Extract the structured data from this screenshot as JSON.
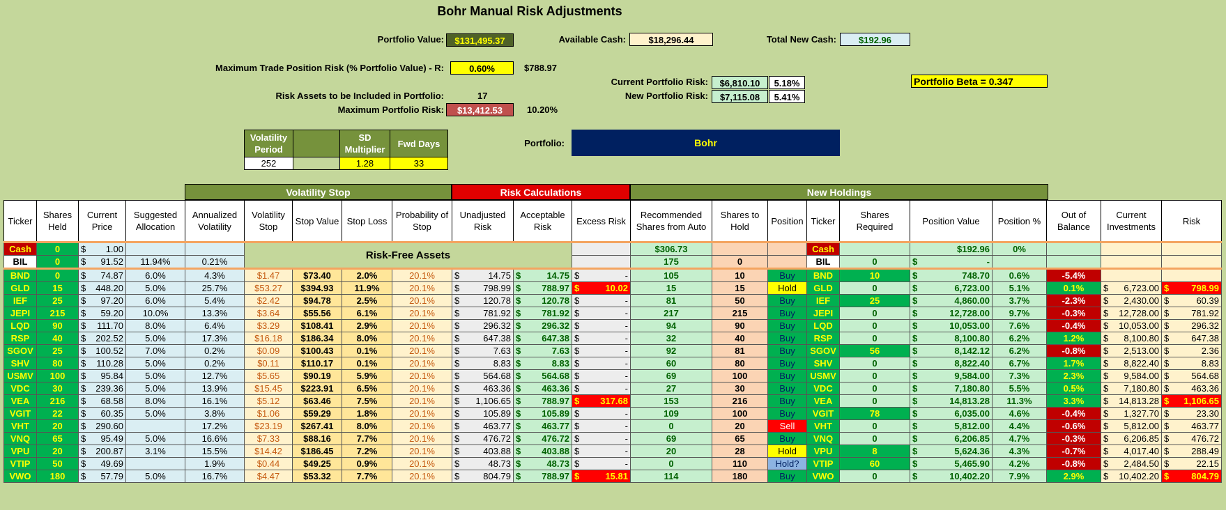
{
  "title": "Bohr Manual Risk Adjustments",
  "summary": {
    "portfolio_value_label": "Portfolio Value:",
    "portfolio_value": "$131,495.37",
    "available_cash_label": "Available Cash:",
    "available_cash": "$18,296.44",
    "total_new_cash_label": "Total New Cash:",
    "total_new_cash": "$192.96",
    "max_trade_risk_label": "Maximum Trade Position Risk (% Portfolio Value) - R:",
    "max_trade_risk_pct": "0.60%",
    "max_trade_risk_amt": "$788.97",
    "current_risk_label": "Current Portfolio Risk:",
    "current_risk_amt": "$6,810.10",
    "current_risk_pct": "5.18%",
    "new_risk_label": "New Portfolio Risk:",
    "new_risk_amt": "$7,115.08",
    "new_risk_pct": "5.41%",
    "beta_label": "Portfolio Beta =  0.347",
    "risk_assets_label": "Risk Assets to be Included in Portfolio:",
    "risk_assets": "17",
    "max_portfolio_risk_label": "Maximum Portfolio Risk:",
    "max_portfolio_risk_amt": "$13,412.53",
    "max_portfolio_risk_pct": "10.20%",
    "portfolio_label": "Portfolio:",
    "portfolio_name": "Bohr"
  },
  "params": {
    "volatility_period_label": "Volatility Period",
    "sd_multiplier_label": "SD Multiplier",
    "fwd_days_label": "Fwd Days",
    "volatility_period": "252",
    "sd_multiplier": "1.28",
    "fwd_days": "33"
  },
  "groups": {
    "volatility_stop": "Volatility Stop",
    "risk_calculations": "Risk Calculations",
    "new_holdings": "New Holdings"
  },
  "headers": [
    "Ticker",
    "Shares Held",
    "Current Price",
    "Suggested Allocation",
    "Annualized Volatility",
    "Volatility Stop",
    "Stop Value",
    "Stop Loss",
    "Probability of Stop",
    "Unadjusted Risk",
    "Acceptable Risk",
    "Excess Risk",
    "Recommended Shares from Auto",
    "Shares to Hold",
    "Position",
    "Ticker",
    "Shares Required",
    "Position Value",
    "Position %",
    "Out of Balance",
    "Current Investments",
    "Risk"
  ],
  "risk_free_label": "Risk-Free Assets",
  "cash_row": {
    "ticker": "Cash",
    "shares": "0",
    "price": "1.00",
    "rec": "$306.73",
    "ticker2": "Cash",
    "posval": "$192.96",
    "pospct": "0%"
  },
  "bil_row": {
    "ticker": "BIL",
    "shares": "0",
    "price": "91.52",
    "alloc": "11.94%",
    "vol": "0.21%",
    "rec": "175",
    "hold": "0",
    "ticker2": "BIL",
    "req": "0",
    "posval": "-"
  },
  "rows": [
    {
      "t": "BND",
      "sh": "0",
      "pr": "74.87",
      "al": "6.0%",
      "av": "4.3%",
      "vs": "$1.47",
      "sv": "$73.40",
      "sl": "2.0%",
      "pb": "20.1%",
      "ur": "14.75",
      "ar": "14.75",
      "er": "-",
      "rec": "105",
      "hold": "10",
      "pos": "Buy",
      "req": "10",
      "pv": "748.70",
      "pp": "0.6%",
      "ob": "-5.4%",
      "ci": "",
      "rk": ""
    },
    {
      "t": "GLD",
      "sh": "15",
      "pr": "448.20",
      "al": "5.0%",
      "av": "25.7%",
      "vs": "$53.27",
      "sv": "$394.93",
      "sl": "11.9%",
      "pb": "20.1%",
      "ur": "798.99",
      "ar": "788.97",
      "er": "10.02",
      "rec": "15",
      "hold": "15",
      "pos": "Hold",
      "req": "0",
      "pv": "6,723.00",
      "pp": "5.1%",
      "ob": "0.1%",
      "ci": "6,723.00",
      "rk": "798.99"
    },
    {
      "t": "IEF",
      "sh": "25",
      "pr": "97.20",
      "al": "6.0%",
      "av": "5.4%",
      "vs": "$2.42",
      "sv": "$94.78",
      "sl": "2.5%",
      "pb": "20.1%",
      "ur": "120.78",
      "ar": "120.78",
      "er": "-",
      "rec": "81",
      "hold": "50",
      "pos": "Buy",
      "req": "25",
      "pv": "4,860.00",
      "pp": "3.7%",
      "ob": "-2.3%",
      "ci": "2,430.00",
      "rk": "60.39"
    },
    {
      "t": "JEPI",
      "sh": "215",
      "pr": "59.20",
      "al": "10.0%",
      "av": "13.3%",
      "vs": "$3.64",
      "sv": "$55.56",
      "sl": "6.1%",
      "pb": "20.1%",
      "ur": "781.92",
      "ar": "781.92",
      "er": "-",
      "rec": "217",
      "hold": "215",
      "pos": "Buy",
      "req": "0",
      "pv": "12,728.00",
      "pp": "9.7%",
      "ob": "-0.3%",
      "ci": "12,728.00",
      "rk": "781.92"
    },
    {
      "t": "LQD",
      "sh": "90",
      "pr": "111.70",
      "al": "8.0%",
      "av": "6.4%",
      "vs": "$3.29",
      "sv": "$108.41",
      "sl": "2.9%",
      "pb": "20.1%",
      "ur": "296.32",
      "ar": "296.32",
      "er": "-",
      "rec": "94",
      "hold": "90",
      "pos": "Buy",
      "req": "0",
      "pv": "10,053.00",
      "pp": "7.6%",
      "ob": "-0.4%",
      "ci": "10,053.00",
      "rk": "296.32"
    },
    {
      "t": "RSP",
      "sh": "40",
      "pr": "202.52",
      "al": "5.0%",
      "av": "17.3%",
      "vs": "$16.18",
      "sv": "$186.34",
      "sl": "8.0%",
      "pb": "20.1%",
      "ur": "647.38",
      "ar": "647.38",
      "er": "-",
      "rec": "32",
      "hold": "40",
      "pos": "Buy",
      "req": "0",
      "pv": "8,100.80",
      "pp": "6.2%",
      "ob": "1.2%",
      "ci": "8,100.80",
      "rk": "647.38"
    },
    {
      "t": "SGOV",
      "sh": "25",
      "pr": "100.52",
      "al": "7.0%",
      "av": "0.2%",
      "vs": "$0.09",
      "sv": "$100.43",
      "sl": "0.1%",
      "pb": "20.1%",
      "ur": "7.63",
      "ar": "7.63",
      "er": "-",
      "rec": "92",
      "hold": "81",
      "pos": "Buy",
      "req": "56",
      "pv": "8,142.12",
      "pp": "6.2%",
      "ob": "-0.8%",
      "ci": "2,513.00",
      "rk": "2.36"
    },
    {
      "t": "SHV",
      "sh": "80",
      "pr": "110.28",
      "al": "5.0%",
      "av": "0.2%",
      "vs": "$0.11",
      "sv": "$110.17",
      "sl": "0.1%",
      "pb": "20.1%",
      "ur": "8.83",
      "ar": "8.83",
      "er": "-",
      "rec": "60",
      "hold": "80",
      "pos": "Buy",
      "req": "0",
      "pv": "8,822.40",
      "pp": "6.7%",
      "ob": "1.7%",
      "ci": "8,822.40",
      "rk": "8.83"
    },
    {
      "t": "USMV",
      "sh": "100",
      "pr": "95.84",
      "al": "5.0%",
      "av": "12.7%",
      "vs": "$5.65",
      "sv": "$90.19",
      "sl": "5.9%",
      "pb": "20.1%",
      "ur": "564.68",
      "ar": "564.68",
      "er": "-",
      "rec": "69",
      "hold": "100",
      "pos": "Buy",
      "req": "0",
      "pv": "9,584.00",
      "pp": "7.3%",
      "ob": "2.3%",
      "ci": "9,584.00",
      "rk": "564.68"
    },
    {
      "t": "VDC",
      "sh": "30",
      "pr": "239.36",
      "al": "5.0%",
      "av": "13.9%",
      "vs": "$15.45",
      "sv": "$223.91",
      "sl": "6.5%",
      "pb": "20.1%",
      "ur": "463.36",
      "ar": "463.36",
      "er": "-",
      "rec": "27",
      "hold": "30",
      "pos": "Buy",
      "req": "0",
      "pv": "7,180.80",
      "pp": "5.5%",
      "ob": "0.5%",
      "ci": "7,180.80",
      "rk": "463.36"
    },
    {
      "t": "VEA",
      "sh": "216",
      "pr": "68.58",
      "al": "8.0%",
      "av": "16.1%",
      "vs": "$5.12",
      "sv": "$63.46",
      "sl": "7.5%",
      "pb": "20.1%",
      "ur": "1,106.65",
      "ar": "788.97",
      "er": "317.68",
      "rec": "153",
      "hold": "216",
      "pos": "Buy",
      "req": "0",
      "pv": "14,813.28",
      "pp": "11.3%",
      "ob": "3.3%",
      "ci": "14,813.28",
      "rk": "1,106.65"
    },
    {
      "t": "VGIT",
      "sh": "22",
      "pr": "60.35",
      "al": "5.0%",
      "av": "3.8%",
      "vs": "$1.06",
      "sv": "$59.29",
      "sl": "1.8%",
      "pb": "20.1%",
      "ur": "105.89",
      "ar": "105.89",
      "er": "-",
      "rec": "109",
      "hold": "100",
      "pos": "Buy",
      "req": "78",
      "pv": "6,035.00",
      "pp": "4.6%",
      "ob": "-0.4%",
      "ci": "1,327.70",
      "rk": "23.30"
    },
    {
      "t": "VHT",
      "sh": "20",
      "pr": "290.60",
      "al": "",
      "av": "17.2%",
      "vs": "$23.19",
      "sv": "$267.41",
      "sl": "8.0%",
      "pb": "20.1%",
      "ur": "463.77",
      "ar": "463.77",
      "er": "-",
      "rec": "0",
      "hold": "20",
      "pos": "Sell",
      "req": "0",
      "pv": "5,812.00",
      "pp": "4.4%",
      "ob": "-0.6%",
      "ci": "5,812.00",
      "rk": "463.77"
    },
    {
      "t": "VNQ",
      "sh": "65",
      "pr": "95.49",
      "al": "5.0%",
      "av": "16.6%",
      "vs": "$7.33",
      "sv": "$88.16",
      "sl": "7.7%",
      "pb": "20.1%",
      "ur": "476.72",
      "ar": "476.72",
      "er": "-",
      "rec": "69",
      "hold": "65",
      "pos": "Buy",
      "req": "0",
      "pv": "6,206.85",
      "pp": "4.7%",
      "ob": "-0.3%",
      "ci": "6,206.85",
      "rk": "476.72"
    },
    {
      "t": "VPU",
      "sh": "20",
      "pr": "200.87",
      "al": "3.1%",
      "av": "15.5%",
      "vs": "$14.42",
      "sv": "$186.45",
      "sl": "7.2%",
      "pb": "20.1%",
      "ur": "403.88",
      "ar": "403.88",
      "er": "-",
      "rec": "20",
      "hold": "28",
      "pos": "Hold",
      "req": "8",
      "pv": "5,624.36",
      "pp": "4.3%",
      "ob": "-0.7%",
      "ci": "4,017.40",
      "rk": "288.49"
    },
    {
      "t": "VTIP",
      "sh": "50",
      "pr": "49.69",
      "al": "",
      "av": "1.9%",
      "vs": "$0.44",
      "sv": "$49.25",
      "sl": "0.9%",
      "pb": "20.1%",
      "ur": "48.73",
      "ar": "48.73",
      "er": "-",
      "rec": "0",
      "hold": "110",
      "pos": "Hold?",
      "req": "60",
      "pv": "5,465.90",
      "pp": "4.2%",
      "ob": "-0.8%",
      "ci": "2,484.50",
      "rk": "22.15"
    },
    {
      "t": "VWO",
      "sh": "180",
      "pr": "57.79",
      "al": "5.0%",
      "av": "16.7%",
      "vs": "$4.47",
      "sv": "$53.32",
      "sl": "7.7%",
      "pb": "20.1%",
      "ur": "804.79",
      "ar": "788.97",
      "er": "15.81",
      "rec": "114",
      "hold": "180",
      "pos": "Buy",
      "req": "0",
      "pv": "10,402.20",
      "pp": "7.9%",
      "ob": "2.9%",
      "ci": "10,402.20",
      "rk": "804.79"
    }
  ],
  "colors": {
    "bg": "#c4d79b",
    "ticker": "#00b050",
    "portfolio_bar": "#002060",
    "red": "#ff0000",
    "olive": "#76923c"
  }
}
